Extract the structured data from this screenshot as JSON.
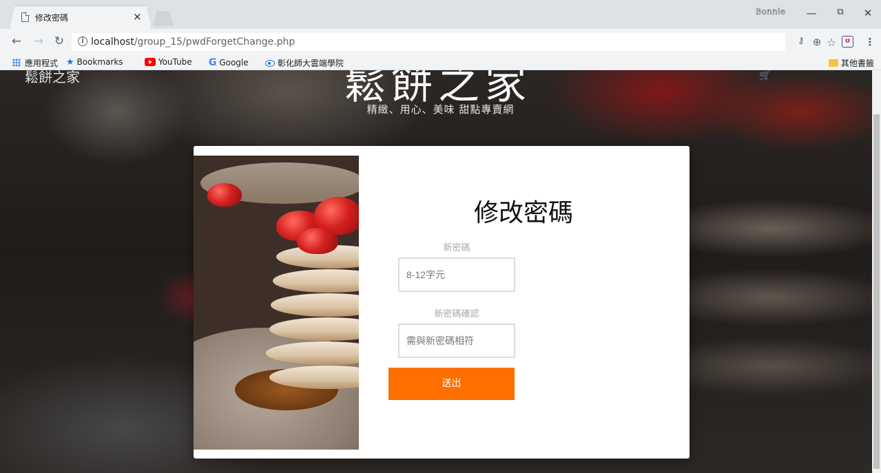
{
  "browser": {
    "tab_title": "修改密碼",
    "tab_close": "×",
    "user_name": "Bonnie",
    "window_controls": {
      "minimize": "—",
      "restore": "⧉",
      "close": "✕"
    },
    "url_host": "localhost",
    "url_path": "/group_15/pwdForgetChange.php",
    "toolbar_icons": [
      "key-icon",
      "zoom-icon",
      "star-icon",
      "extension-icon",
      "menu-icon"
    ]
  },
  "bookmarks": {
    "apps": "應用程式",
    "items": [
      {
        "label": "Bookmarks",
        "icon": "star-icon"
      },
      {
        "label": "YouTube",
        "icon": "youtube-icon"
      },
      {
        "label": "Google",
        "icon": "google-icon"
      },
      {
        "label": "彰化師大雲端學院",
        "icon": "eye-icon"
      }
    ],
    "other": "其他書籤"
  },
  "site": {
    "logo": "鬆餅之家",
    "hero_title": "鬆餅之家",
    "hero_subtitle": "精緻、用心、美味 甜點專賣網"
  },
  "form": {
    "title": "修改密碼",
    "new_password_label": "新密碼",
    "new_password_placeholder": "8-12字元",
    "confirm_label": "新密碼確認",
    "confirm_placeholder": "需與新密碼相符",
    "submit_label": "送出"
  },
  "colors": {
    "accent": "#ff6f00",
    "card": "#ffffff"
  }
}
